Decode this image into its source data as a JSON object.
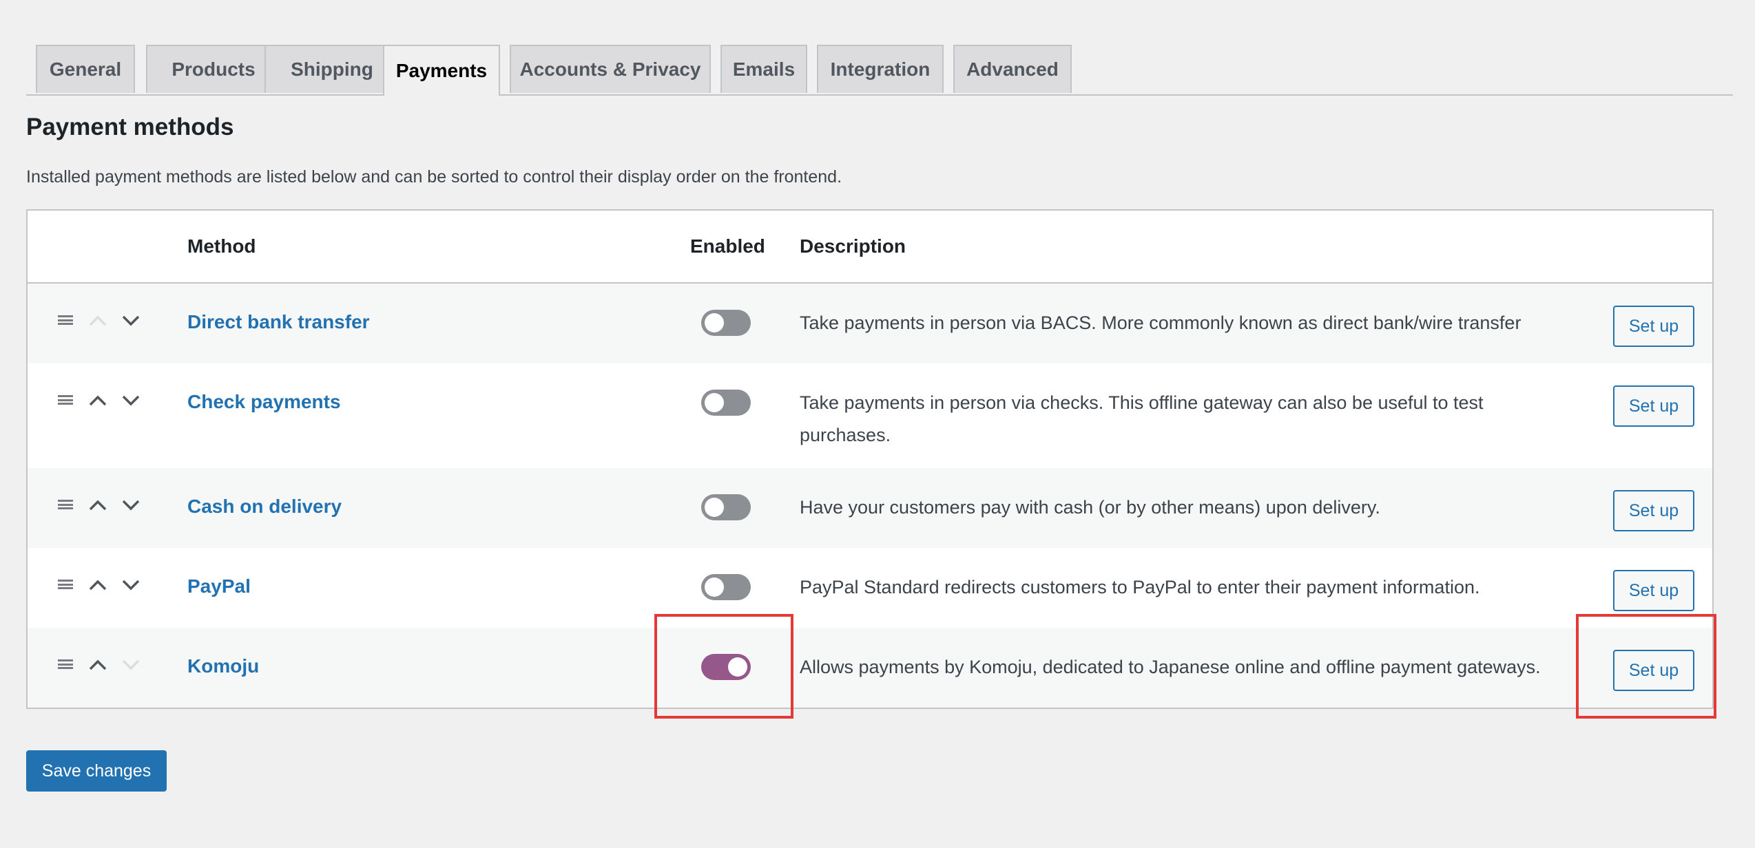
{
  "tabs": [
    {
      "label": "General"
    },
    {
      "label": "Products"
    },
    {
      "label": "Shipping"
    },
    {
      "label": "Payments",
      "active": true
    },
    {
      "label": "Accounts & Privacy"
    },
    {
      "label": "Emails"
    },
    {
      "label": "Integration"
    },
    {
      "label": "Advanced"
    }
  ],
  "page": {
    "title": "Payment methods",
    "intro": "Installed payment methods are listed below and can be sorted to control their display order on the frontend."
  },
  "table": {
    "headers": {
      "method": "Method",
      "enabled": "Enabled",
      "description": "Description"
    },
    "rows": [
      {
        "name": "Direct bank transfer",
        "enabled": false,
        "description": "Take payments in person via BACS. More commonly known as direct bank/wire transfer",
        "action": "Set up",
        "up_disabled": true,
        "down_disabled": false
      },
      {
        "name": "Check payments",
        "enabled": false,
        "description": "Take payments in person via checks. This offline gateway can also be useful to test purchases.",
        "action": "Set up",
        "up_disabled": false,
        "down_disabled": false
      },
      {
        "name": "Cash on delivery",
        "enabled": false,
        "description": "Have your customers pay with cash (or by other means) upon delivery.",
        "action": "Set up",
        "up_disabled": false,
        "down_disabled": false
      },
      {
        "name": "PayPal",
        "enabled": false,
        "description": "PayPal Standard redirects customers to PayPal to enter their payment information.",
        "action": "Set up",
        "up_disabled": false,
        "down_disabled": false
      },
      {
        "name": "Komoju",
        "enabled": true,
        "description": "Allows payments by Komoju, dedicated to Japanese online and offline payment gateways.",
        "action": "Set up",
        "up_disabled": false,
        "down_disabled": true
      }
    ]
  },
  "save_label": "Save changes",
  "colors": {
    "link": "#2271b1",
    "toggle_on": "#96588a",
    "toggle_off": "#8c8f94",
    "highlight": "#e53935"
  }
}
